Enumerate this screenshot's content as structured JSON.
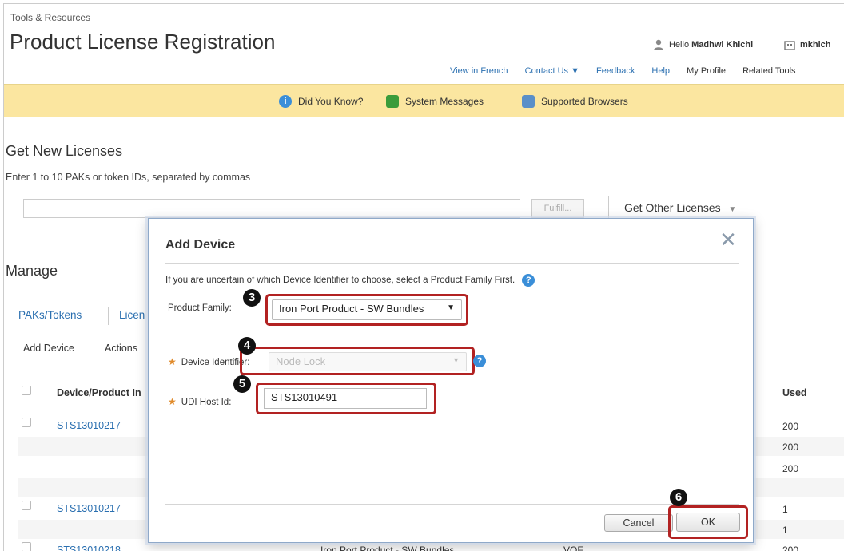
{
  "header": {
    "breadcrumb": "Tools & Resources",
    "title": "Product License Registration",
    "greeting_prefix": "Hello",
    "user_name": "Madhwi Khichi",
    "account": "mkhich",
    "links": [
      "View in French",
      "Contact Us ▼",
      "Feedback",
      "Help",
      "My Profile",
      "Related Tools"
    ]
  },
  "banner": {
    "did_you_know": "Did You Know?",
    "system_messages": "System Messages",
    "supported_browsers": "Supported Browsers"
  },
  "get_licenses": {
    "heading": "Get New Licenses",
    "instructions": "Enter 1 to 10 PAKs or token IDs, separated by commas",
    "pak_value": "",
    "fulfill_label": "Fulfill...",
    "other_label": "Get Other Licenses"
  },
  "manage": {
    "heading": "Manage",
    "tabs": [
      "PAKs/Tokens",
      "Licen"
    ],
    "actions": [
      "Add Device",
      "Actions"
    ],
    "col_device": "Device/Product In",
    "col_used": "Used",
    "rows": [
      {
        "device": "STS13010217",
        "used": "200"
      },
      {
        "device": "",
        "used": "200"
      },
      {
        "device": "",
        "used": "200"
      },
      {
        "device": "",
        "used": ""
      },
      {
        "device": "STS13010217",
        "used": "1"
      },
      {
        "device": "",
        "used": "1"
      },
      {
        "device": "STS13010218",
        "product": "Iron Port Product - SW Bundles",
        "type": "VOF",
        "used": "200"
      }
    ]
  },
  "modal": {
    "title": "Add Device",
    "close": "✕",
    "hint": "If you are uncertain of which Device Identifier to choose, select a Product Family First.",
    "product_family_label": "Product Family:",
    "product_family_value": "Iron Port Product - SW Bundles",
    "device_identifier_label": "Device Identifier:",
    "device_identifier_value": "Node Lock",
    "udi_label": "UDI Host Id:",
    "udi_value": "STS13010491",
    "cancel_label": "Cancel",
    "ok_label": "OK",
    "steps": [
      "3",
      "4",
      "5",
      "6"
    ]
  },
  "colors": {
    "accent": "#b22222",
    "link": "#2a6fb0",
    "banner": "#fbe6a0",
    "help": "#3a8ed8"
  }
}
